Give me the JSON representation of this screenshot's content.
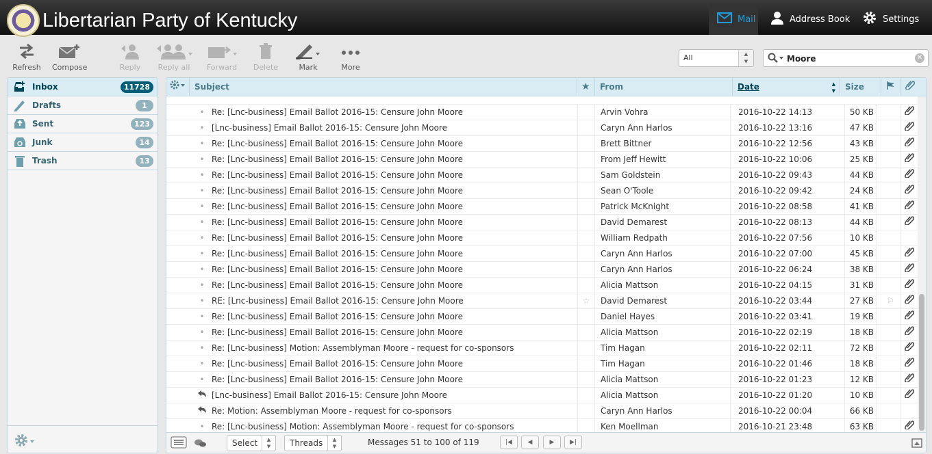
{
  "header": {
    "title": "Libertarian Party of Kentucky",
    "nav": [
      {
        "label": "Mail",
        "icon": "envelope-icon",
        "active": true
      },
      {
        "label": "Address Book",
        "icon": "person-icon"
      },
      {
        "label": "Settings",
        "icon": "gear-icon"
      }
    ]
  },
  "toolbar": {
    "refresh": "Refresh",
    "compose": "Compose",
    "reply": "Reply",
    "reply_all": "Reply all",
    "forward": "Forward",
    "delete": "Delete",
    "mark": "Mark",
    "more": "More",
    "filter_value": "All",
    "search_value": "Moore"
  },
  "folders": [
    {
      "name": "Inbox",
      "count": "11728",
      "icon": "inbox-icon",
      "selected": true
    },
    {
      "name": "Drafts",
      "count": "1",
      "icon": "pencil-icon"
    },
    {
      "name": "Sent",
      "count": "123",
      "icon": "sent-icon"
    },
    {
      "name": "Junk",
      "count": "14",
      "icon": "junk-icon"
    },
    {
      "name": "Trash",
      "count": "13",
      "icon": "trash-icon"
    }
  ],
  "list_header": {
    "subject": "Subject",
    "from": "From",
    "date": "Date",
    "size": "Size"
  },
  "messages": [
    {
      "subject": "Re: [Lnc-business] Email Ballot 2016-15: Censure John Moore",
      "from": "Arvin Vohra",
      "date": "2016-10-22 14:13",
      "size": "50 KB",
      "attachment": true,
      "status": "dot"
    },
    {
      "subject": "[Lnc-business] Email Ballot 2016-15: Censure John Moore",
      "from": "Caryn Ann Harlos",
      "date": "2016-10-22 13:16",
      "size": "47 KB",
      "attachment": true,
      "status": "dot"
    },
    {
      "subject": "Re: [Lnc-business] Email Ballot 2016-15: Censure John Moore",
      "from": "Brett Bittner",
      "date": "2016-10-22 12:56",
      "size": "43 KB",
      "attachment": true,
      "status": "dot"
    },
    {
      "subject": "Re: [Lnc-business] Email Ballot 2016-15: Censure John Moore",
      "from": "From Jeff Hewitt",
      "date": "2016-10-22 10:06",
      "size": "25 KB",
      "attachment": true,
      "status": "dot"
    },
    {
      "subject": "Re: [Lnc-business] Email Ballot 2016-15: Censure John Moore",
      "from": "Sam Goldstein",
      "date": "2016-10-22 09:43",
      "size": "44 KB",
      "attachment": true,
      "status": "dot"
    },
    {
      "subject": "Re: [Lnc-business] Email Ballot 2016-15: Censure John Moore",
      "from": "Sean O'Toole",
      "date": "2016-10-22 09:42",
      "size": "24 KB",
      "attachment": true,
      "status": "dot"
    },
    {
      "subject": "Re: [Lnc-business] Email Ballot 2016-15: Censure John Moore",
      "from": "Patrick McKnight",
      "date": "2016-10-22 08:58",
      "size": "41 KB",
      "attachment": true,
      "status": "dot"
    },
    {
      "subject": "Re: [Lnc-business] Email Ballot 2016-15: Censure John Moore",
      "from": "David Demarest",
      "date": "2016-10-22 08:13",
      "size": "44 KB",
      "attachment": true,
      "status": "dot"
    },
    {
      "subject": "Re: [Lnc-business] Email Ballot 2016-15: Censure John Moore",
      "from": "William Redpath",
      "date": "2016-10-22 07:56",
      "size": "10 KB",
      "attachment": false,
      "status": "dot"
    },
    {
      "subject": "Re: [Lnc-business] Email Ballot 2016-15: Censure John Moore",
      "from": "Caryn Ann Harlos",
      "date": "2016-10-22 07:00",
      "size": "45 KB",
      "attachment": true,
      "status": "dot"
    },
    {
      "subject": "Re: [Lnc-business] Email Ballot 2016-15: Censure John Moore",
      "from": "Caryn Ann Harlos",
      "date": "2016-10-22 06:24",
      "size": "38 KB",
      "attachment": true,
      "status": "dot"
    },
    {
      "subject": "Re: [Lnc-business] Email Ballot 2016-15: Censure John Moore",
      "from": "Alicia Mattson",
      "date": "2016-10-22 04:15",
      "size": "31 KB",
      "attachment": true,
      "status": "dot"
    },
    {
      "subject": "RE: [Lnc-business] Email Ballot 2016-15: Censure John Moore",
      "from": "David Demarest",
      "date": "2016-10-22 03:44",
      "size": "27 KB",
      "attachment": true,
      "status": "dot",
      "hover": true
    },
    {
      "subject": "Re: [Lnc-business] Email Ballot 2016-15: Censure John Moore",
      "from": "Daniel Hayes",
      "date": "2016-10-22 03:41",
      "size": "19 KB",
      "attachment": true,
      "status": "dot"
    },
    {
      "subject": "Re: [Lnc-business] Email Ballot 2016-15: Censure John Moore",
      "from": "Alicia Mattson",
      "date": "2016-10-22 02:19",
      "size": "18 KB",
      "attachment": true,
      "status": "dot"
    },
    {
      "subject": "Re: [Lnc-business] Motion: Assemblyman Moore - request for co-sponsors",
      "from": "Tim Hagan",
      "date": "2016-10-22 02:11",
      "size": "72 KB",
      "attachment": true,
      "status": "dot"
    },
    {
      "subject": "Re: [Lnc-business] Email Ballot 2016-15: Censure John Moore",
      "from": "Tim Hagan",
      "date": "2016-10-22 01:46",
      "size": "18 KB",
      "attachment": true,
      "status": "dot"
    },
    {
      "subject": "Re: [Lnc-business] Email Ballot 2016-15: Censure John Moore",
      "from": "Alicia Mattson",
      "date": "2016-10-22 01:23",
      "size": "12 KB",
      "attachment": true,
      "status": "dot"
    },
    {
      "subject": "[Lnc-business] Email Ballot 2016-15: Censure John Moore",
      "from": "Alicia Mattson",
      "date": "2016-10-22 01:20",
      "size": "10 KB",
      "attachment": true,
      "status": "replied"
    },
    {
      "subject": "Re: Motion: Assemblyman Moore - request for co-sponsors",
      "from": "Caryn Ann Harlos",
      "date": "2016-10-22 00:04",
      "size": "66 KB",
      "attachment": false,
      "status": "replied"
    },
    {
      "subject": "Re: [Lnc-business] Motion: Assemblyman Moore - request for co-sponsors",
      "from": "Ken Moellman",
      "date": "2016-10-21 23:48",
      "size": "63 KB",
      "attachment": true,
      "status": "dot"
    }
  ],
  "footer": {
    "select_label": "Select",
    "threads_label": "Threads",
    "count_text": "Messages 51 to 100 of 119"
  }
}
